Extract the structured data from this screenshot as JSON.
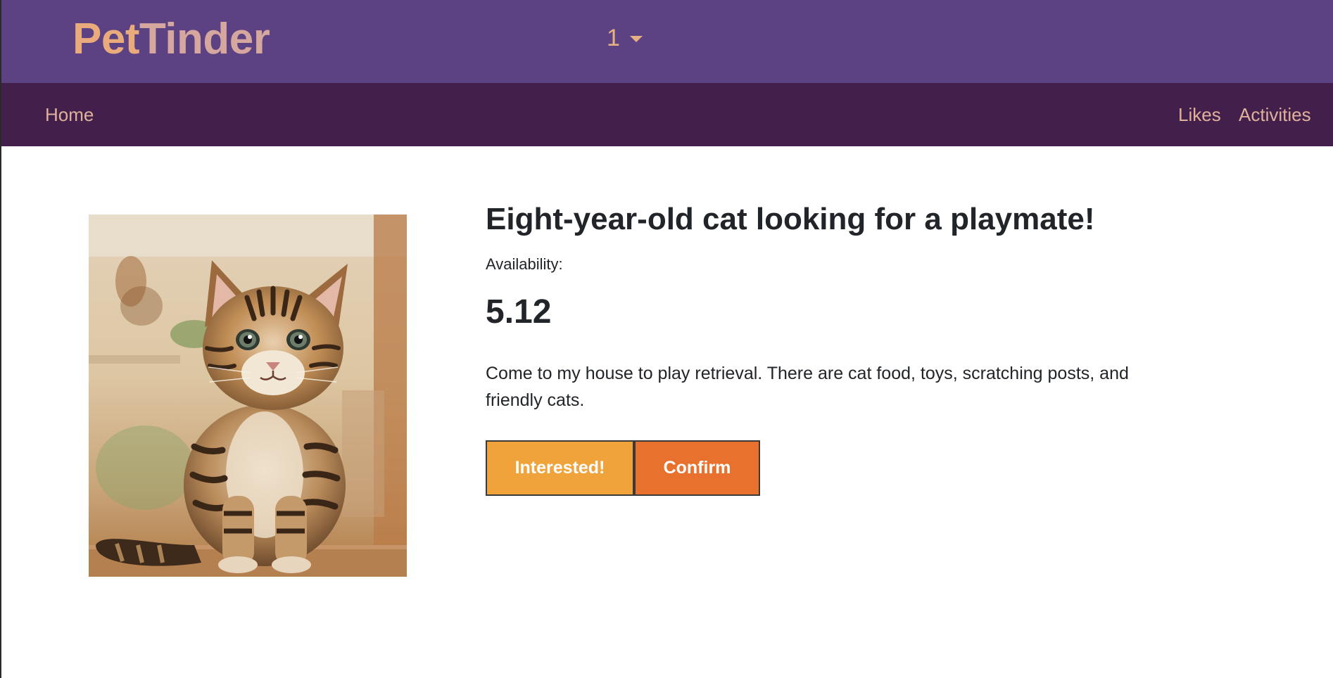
{
  "header": {
    "brand_part1": "Pet",
    "brand_part2": "Tinder",
    "user_selector": "1"
  },
  "nav": {
    "home": "Home",
    "likes": "Likes",
    "activities": "Activities"
  },
  "listing": {
    "title": "Eight-year-old cat looking for a playmate!",
    "availability_label": "Availability:",
    "availability_value": "5.12",
    "description": "Come to my house to play retrieval. There are cat food, toys, scratching posts, and friendly cats.",
    "interested_label": "Interested!",
    "confirm_label": "Confirm"
  },
  "colors": {
    "header_bg": "#5c4283",
    "nav_bg": "#43204b",
    "brand_accent": "#e9ab7b",
    "interested_button": "#f0a33a",
    "confirm_button": "#e8712d"
  },
  "icons": {
    "dropdown": "caret-down-icon"
  }
}
